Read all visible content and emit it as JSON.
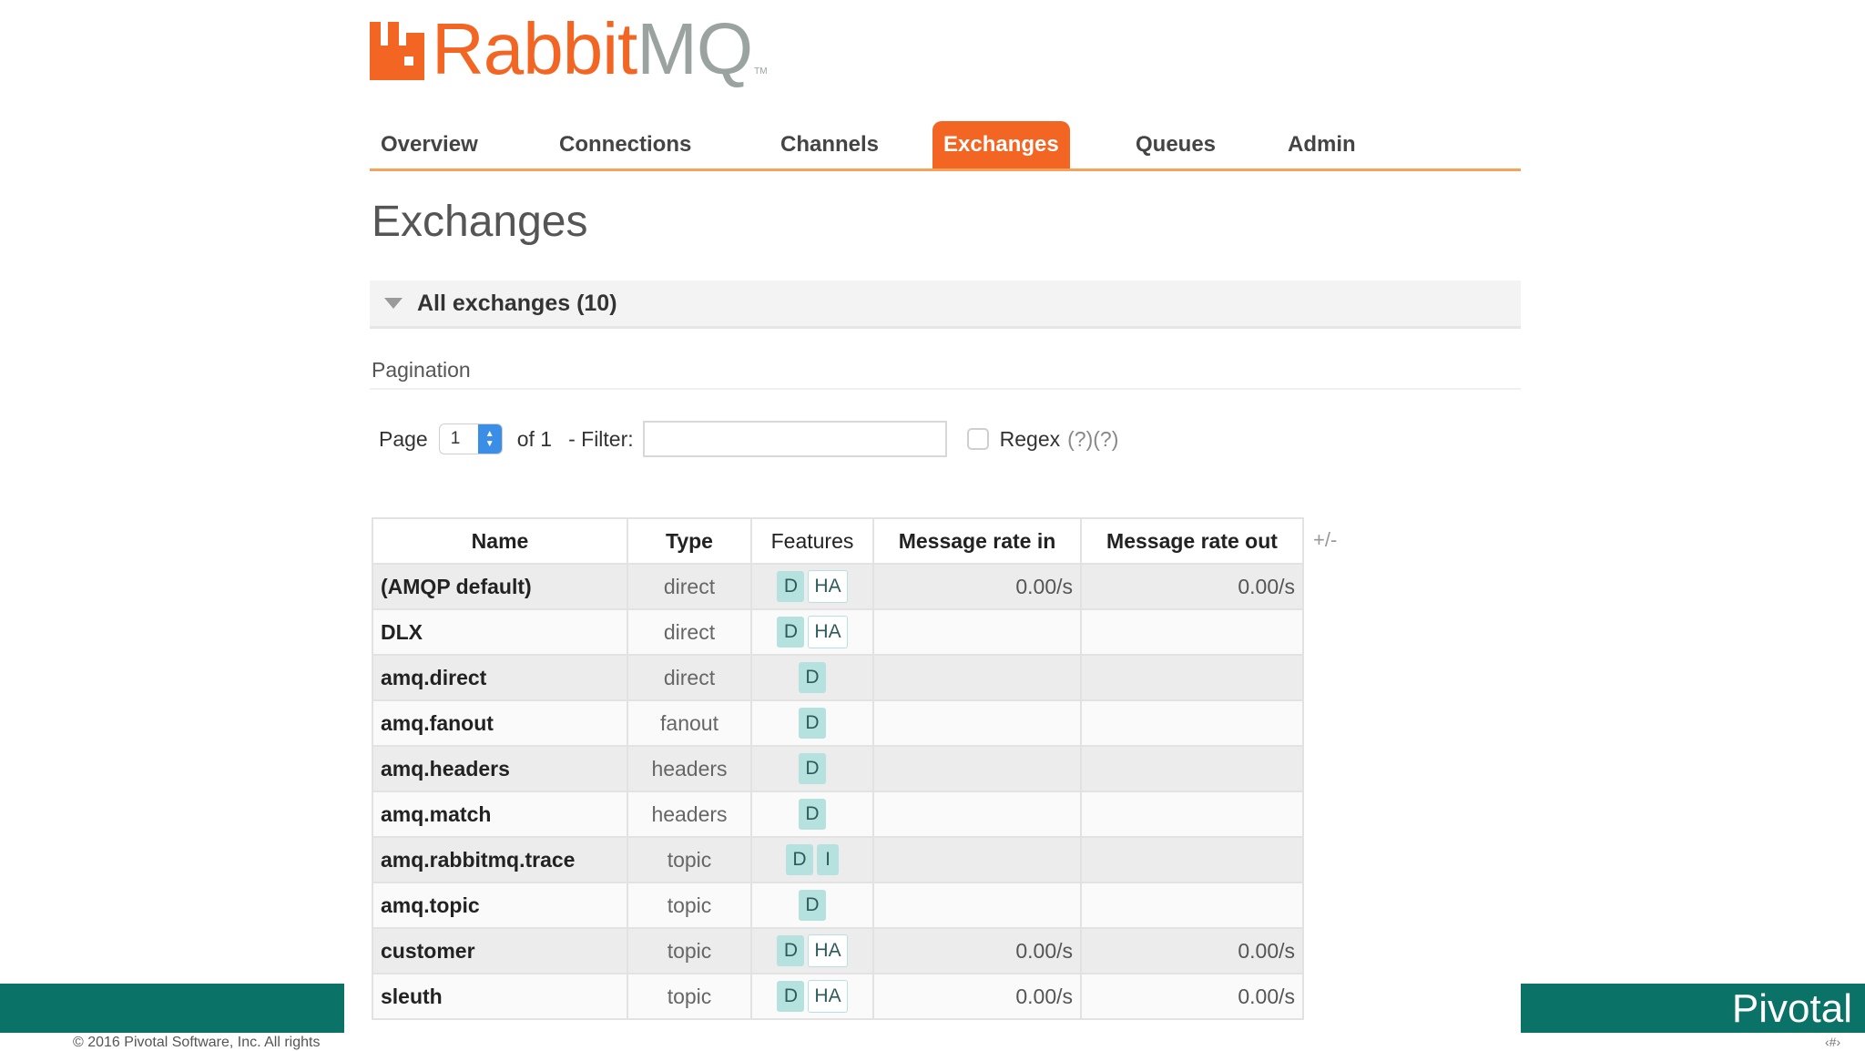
{
  "logo": {
    "part1": "Rabbit",
    "part2": "MQ",
    "tm": "TM"
  },
  "nav": {
    "tabs": [
      {
        "label": "Overview"
      },
      {
        "label": "Connections"
      },
      {
        "label": "Channels"
      },
      {
        "label": "Exchanges",
        "active": true
      },
      {
        "label": "Queues"
      },
      {
        "label": "Admin"
      }
    ]
  },
  "page_title": "Exchanges",
  "section": {
    "title": "All exchanges (10)"
  },
  "pagination": {
    "label": "Pagination",
    "page_label": "Page",
    "page_value": "1",
    "of_text": "of 1",
    "filter_label": "- Filter:",
    "filter_value": "",
    "regex_label": "Regex",
    "regex_help": "(?)(?)"
  },
  "table": {
    "headers": [
      "Name",
      "Type",
      "Features",
      "Message rate in",
      "Message rate out"
    ],
    "plus_minus": "+/-",
    "rows": [
      {
        "name": "(AMQP default)",
        "type": "direct",
        "features": [
          "D",
          "HA"
        ],
        "rate_in": "0.00/s",
        "rate_out": "0.00/s"
      },
      {
        "name": "DLX",
        "type": "direct",
        "features": [
          "D",
          "HA"
        ],
        "rate_in": "",
        "rate_out": ""
      },
      {
        "name": "amq.direct",
        "type": "direct",
        "features": [
          "D"
        ],
        "rate_in": "",
        "rate_out": ""
      },
      {
        "name": "amq.fanout",
        "type": "fanout",
        "features": [
          "D"
        ],
        "rate_in": "",
        "rate_out": ""
      },
      {
        "name": "amq.headers",
        "type": "headers",
        "features": [
          "D"
        ],
        "rate_in": "",
        "rate_out": ""
      },
      {
        "name": "amq.match",
        "type": "headers",
        "features": [
          "D"
        ],
        "rate_in": "",
        "rate_out": ""
      },
      {
        "name": "amq.rabbitmq.trace",
        "type": "topic",
        "features": [
          "D",
          "I"
        ],
        "rate_in": "",
        "rate_out": ""
      },
      {
        "name": "amq.topic",
        "type": "topic",
        "features": [
          "D"
        ],
        "rate_in": "",
        "rate_out": ""
      },
      {
        "name": "customer",
        "type": "topic",
        "features": [
          "D",
          "HA"
        ],
        "rate_in": "0.00/s",
        "rate_out": "0.00/s"
      },
      {
        "name": "sleuth",
        "type": "topic",
        "features": [
          "D",
          "HA"
        ],
        "rate_in": "0.00/s",
        "rate_out": "0.00/s"
      }
    ]
  },
  "footer": {
    "copyright": "© 2016 Pivotal Software, Inc. All rights",
    "brand": "Pivotal",
    "slide_number": "‹#›"
  },
  "colors": {
    "accent": "#f26522",
    "nav_underline": "#f5a25a",
    "badge": "#b5e1de",
    "footer_bar": "#0b7268"
  }
}
